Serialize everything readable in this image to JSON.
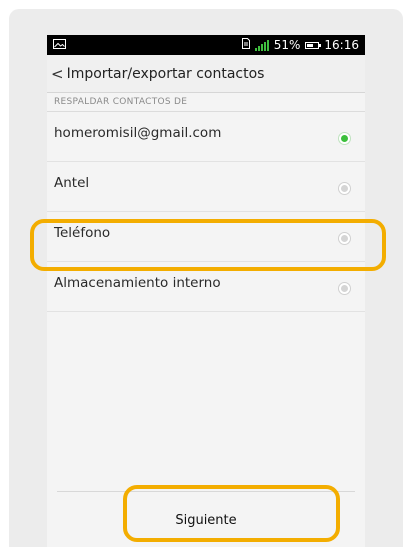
{
  "status_bar": {
    "battery": "51%",
    "time": "16:16",
    "icons": [
      "image-icon",
      "sim-icon",
      "signal-icon",
      "battery-icon"
    ]
  },
  "header": {
    "back_glyph": "<",
    "title": "Importar/exportar contactos"
  },
  "section": {
    "title": "RESPALDAR CONTACTOS DE"
  },
  "options": [
    {
      "label": "homeromisil@gmail.com",
      "selected": true
    },
    {
      "label": "Antel",
      "selected": false
    },
    {
      "label": "Teléfono",
      "selected": false
    },
    {
      "label": "Almacenamiento interno",
      "selected": false
    }
  ],
  "footer": {
    "next_label": "Siguiente"
  },
  "colors": {
    "accent_green": "#3bbf3b",
    "highlight": "#f3ad00",
    "statusbar": "#000000"
  }
}
